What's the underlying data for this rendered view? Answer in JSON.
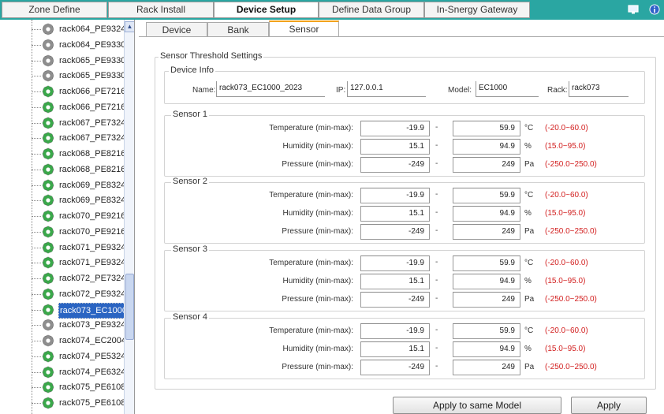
{
  "top_menu": {
    "items": [
      "Zone Define",
      "Rack Install",
      "Device Setup",
      "Define Data Group",
      "In-Snergy Gateway"
    ],
    "active": "Device Setup"
  },
  "tree": {
    "items": [
      {
        "label": "rack064_PE9324",
        "color": "gray"
      },
      {
        "label": "rack064_PE9330",
        "color": "gray"
      },
      {
        "label": "rack065_PE9330",
        "color": "gray"
      },
      {
        "label": "rack065_PE9330",
        "color": "gray"
      },
      {
        "label": "rack066_PE7216",
        "color": "green"
      },
      {
        "label": "rack066_PE7216",
        "color": "green"
      },
      {
        "label": "rack067_PE7324",
        "color": "green"
      },
      {
        "label": "rack067_PE7324",
        "color": "green"
      },
      {
        "label": "rack068_PE8216",
        "color": "green"
      },
      {
        "label": "rack068_PE8216",
        "color": "green"
      },
      {
        "label": "rack069_PE8324",
        "color": "green"
      },
      {
        "label": "rack069_PE8324",
        "color": "green"
      },
      {
        "label": "rack070_PE9216",
        "color": "green"
      },
      {
        "label": "rack070_PE9216",
        "color": "green"
      },
      {
        "label": "rack071_PE9324",
        "color": "green"
      },
      {
        "label": "rack071_PE9324",
        "color": "green"
      },
      {
        "label": "rack072_PE7324",
        "color": "green"
      },
      {
        "label": "rack072_PE9324",
        "color": "green"
      },
      {
        "label": "rack073_EC1000",
        "color": "green",
        "selected": true
      },
      {
        "label": "rack073_PE9324",
        "color": "gray"
      },
      {
        "label": "rack074_EC2004",
        "color": "gray"
      },
      {
        "label": "rack074_PE5324",
        "color": "green"
      },
      {
        "label": "rack074_PE6324",
        "color": "green"
      },
      {
        "label": "rack075_PE6108",
        "color": "green"
      },
      {
        "label": "rack075_PE6108",
        "color": "green"
      }
    ]
  },
  "tabs": [
    "Device",
    "Bank",
    "Sensor"
  ],
  "active_tab": "Sensor",
  "threshold": {
    "title": "Sensor Threshold Settings",
    "device_info": {
      "title": "Device Info",
      "name_label": "Name:",
      "name_value": "rack073_EC1000_2023",
      "ip_label": "IP:",
      "ip_value": "127.0.0.1",
      "model_label": "Model:",
      "model_value": "EC1000",
      "rack_label": "Rack:",
      "rack_value": "rack073"
    },
    "sensors": [
      {
        "title": "Sensor 1",
        "rows": [
          {
            "label": "Temperature (min-max):",
            "min": "-19.9",
            "max": "59.9",
            "unit": "°C",
            "range": "(-20.0~60.0)"
          },
          {
            "label": "Humidity (min-max):",
            "min": "15.1",
            "max": "94.9",
            "unit": "%",
            "range": "(15.0~95.0)"
          },
          {
            "label": "Pressure (min-max):",
            "min": "-249",
            "max": "249",
            "unit": "Pa",
            "range": "(-250.0~250.0)"
          }
        ]
      },
      {
        "title": "Sensor 2",
        "rows": [
          {
            "label": "Temperature (min-max):",
            "min": "-19.9",
            "max": "59.9",
            "unit": "°C",
            "range": "(-20.0~60.0)"
          },
          {
            "label": "Humidity (min-max):",
            "min": "15.1",
            "max": "94.9",
            "unit": "%",
            "range": "(15.0~95.0)"
          },
          {
            "label": "Pressure (min-max):",
            "min": "-249",
            "max": "249",
            "unit": "Pa",
            "range": "(-250.0~250.0)"
          }
        ]
      },
      {
        "title": "Sensor 3",
        "rows": [
          {
            "label": "Temperature (min-max):",
            "min": "-19.9",
            "max": "59.9",
            "unit": "°C",
            "range": "(-20.0~60.0)"
          },
          {
            "label": "Humidity (min-max):",
            "min": "15.1",
            "max": "94.9",
            "unit": "%",
            "range": "(15.0~95.0)"
          },
          {
            "label": "Pressure (min-max):",
            "min": "-249",
            "max": "249",
            "unit": "Pa",
            "range": "(-250.0~250.0)"
          }
        ]
      },
      {
        "title": "Sensor 4",
        "rows": [
          {
            "label": "Temperature (min-max):",
            "min": "-19.9",
            "max": "59.9",
            "unit": "°C",
            "range": "(-20.0~60.0)"
          },
          {
            "label": "Humidity (min-max):",
            "min": "15.1",
            "max": "94.9",
            "unit": "%",
            "range": "(15.0~95.0)"
          },
          {
            "label": "Pressure (min-max):",
            "min": "-249",
            "max": "249",
            "unit": "Pa",
            "range": "(-250.0~250.0)"
          }
        ]
      }
    ],
    "dash": "-"
  },
  "buttons": {
    "apply_same": "Apply to same Model",
    "apply": "Apply"
  },
  "icons": {
    "monitor": "monitor-icon",
    "info": "info-icon",
    "tree_node": "gear-device-icon",
    "scroll_up": "chevron-up-icon"
  },
  "colors": {
    "topbar": "#2aa6a2",
    "active_tab_accent": "#f2a21c",
    "range_text": "#d21e1e",
    "selection": "#2a64c2",
    "device_green": "#3aa84a",
    "device_gray": "#8e8e8e"
  }
}
